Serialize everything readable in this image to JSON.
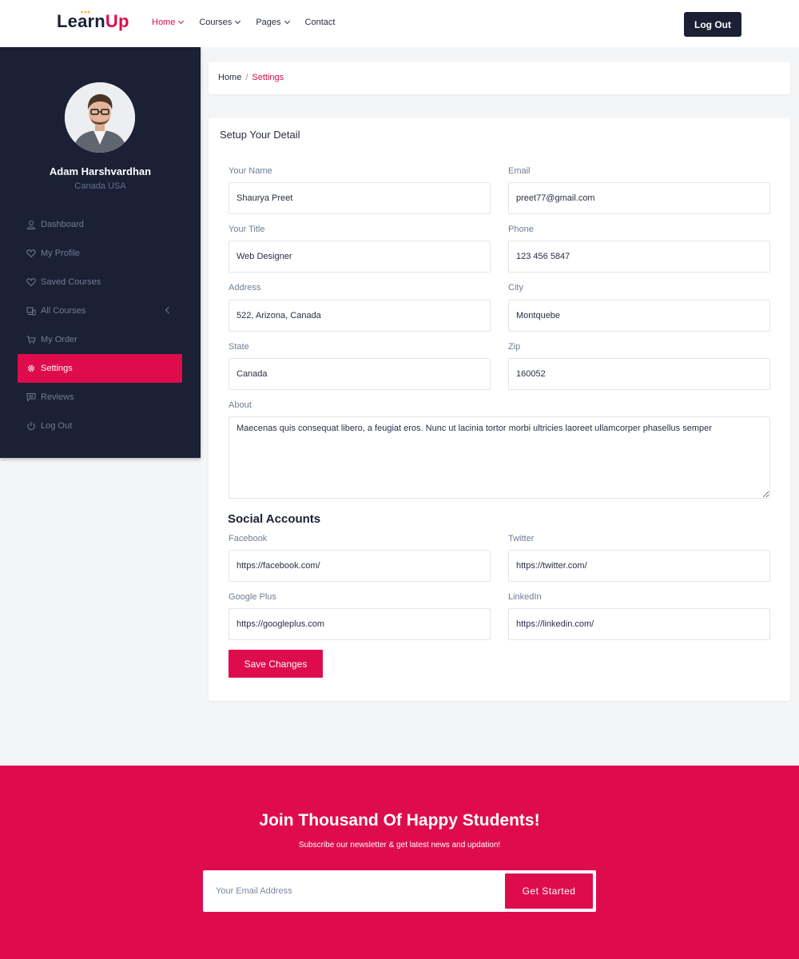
{
  "brand": {
    "part1": "Learn",
    "part2": "Up",
    "accent": "#de0b4d",
    "dark": "#1b2035"
  },
  "nav": [
    {
      "label": "Home",
      "active": true
    },
    {
      "label": "Courses",
      "active": false
    },
    {
      "label": "Pages",
      "active": false
    },
    {
      "label": "Contact",
      "active": false
    }
  ],
  "header": {
    "logout_label": "Log Out"
  },
  "sidebar": {
    "user_name": "Adam Harshvardhan",
    "user_location": "Canada USA",
    "items": [
      {
        "label": "Dashboard",
        "icon": "user-icon"
      },
      {
        "label": "My Profile",
        "icon": "heart-icon"
      },
      {
        "label": "Saved Courses",
        "icon": "heart-icon"
      },
      {
        "label": "All Courses",
        "icon": "devices-icon"
      },
      {
        "label": "My Order",
        "icon": "cart-icon"
      },
      {
        "label": "Settings",
        "icon": "gear-icon",
        "active": true
      },
      {
        "label": "Reviews",
        "icon": "comment-icon"
      },
      {
        "label": "Log Out",
        "icon": "power-icon"
      }
    ]
  },
  "breadcrumb": {
    "home": "Home",
    "separator": "/",
    "current": "Settings"
  },
  "form": {
    "title": "Setup Your Detail",
    "fields": {
      "name": {
        "label": "Your Name",
        "value": "Shaurya Preet"
      },
      "email": {
        "label": "Email",
        "value": "preet77@gmail.com"
      },
      "title": {
        "label": "Your Title",
        "value": "Web Designer"
      },
      "phone": {
        "label": "Phone",
        "value": "123 456 5847"
      },
      "address": {
        "label": "Address",
        "value": "522, Arizona, Canada"
      },
      "city": {
        "label": "City",
        "value": "Montquebe"
      },
      "state": {
        "label": "State",
        "value": "Canada"
      },
      "zip": {
        "label": "Zip",
        "value": "160052"
      },
      "about": {
        "label": "About",
        "value": "Maecenas quis consequat libero, a feugiat eros. Nunc ut lacinia tortor morbi ultricies laoreet ullamcorper phasellus semper"
      }
    },
    "social_title": "Social Accounts",
    "social": {
      "facebook": {
        "label": "Facebook",
        "value": "https://facebook.com/"
      },
      "twitter": {
        "label": "Twitter",
        "value": "https://twitter.com/"
      },
      "googleplus": {
        "label": "Google Plus",
        "value": "https://googleplus.com"
      },
      "linkedin": {
        "label": "LinkedIn",
        "value": "https://linkedin.com/"
      }
    },
    "save_label": "Save Changes"
  },
  "newsletter": {
    "title": "Join Thousand Of Happy Students!",
    "subtitle": "Subscribe our newsletter & get latest news and updation!",
    "placeholder": "Your Email Address",
    "button": "Get Started"
  }
}
